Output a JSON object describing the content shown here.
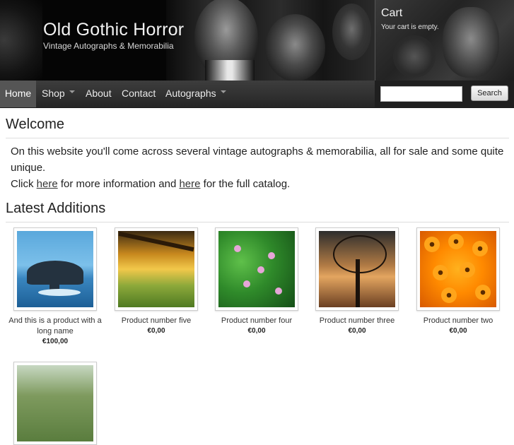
{
  "header": {
    "title": "Old Gothic Horror",
    "tagline": "Vintage Autographs & Memorabilia"
  },
  "cart": {
    "title": "Cart",
    "status": "Your cart is empty."
  },
  "nav": {
    "items": [
      {
        "label": "Home",
        "active": true
      },
      {
        "label": "Shop",
        "dropdown": true
      },
      {
        "label": "About"
      },
      {
        "label": "Contact"
      },
      {
        "label": "Autographs",
        "dropdown": true
      }
    ]
  },
  "search": {
    "value": "",
    "button_label": "Search"
  },
  "welcome": {
    "heading": "Welcome",
    "line1": "On this website you'll come across several vintage autographs & memorabilia, all for sale and some quite unique.",
    "line2_pre": "Click ",
    "link1": "here",
    "line2_mid": " for more information and ",
    "link2": "here",
    "line2_post": " for the full catalog."
  },
  "latest": {
    "heading": "Latest Additions",
    "products": [
      {
        "name": "And this is a product with a long name",
        "price": "€100,00"
      },
      {
        "name": "Product number five",
        "price": "€0,00"
      },
      {
        "name": "Product number four",
        "price": "€0,00"
      },
      {
        "name": "Product number three",
        "price": "€0,00"
      },
      {
        "name": "Product number two",
        "price": "€0,00"
      }
    ]
  },
  "colors": {
    "header_bg": "#050505",
    "nav_bg": "#2e2e2e",
    "nav_active": "#555555",
    "text": "#222222"
  }
}
